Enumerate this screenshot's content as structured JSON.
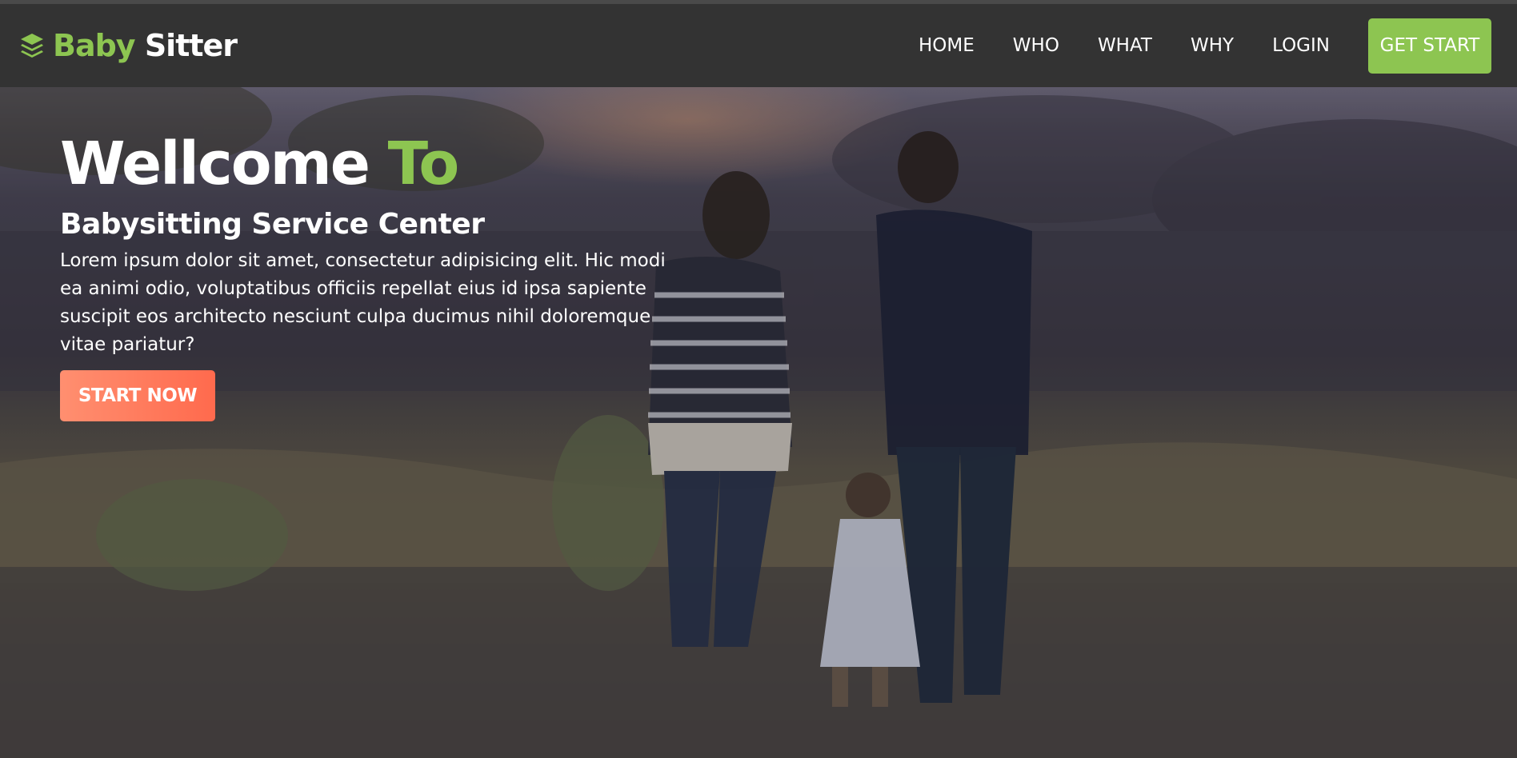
{
  "brand": {
    "logo_icon": "stacked-layers-icon",
    "name_part1": "Baby",
    "name_part2": "Sitter",
    "accent_color": "#8dc551"
  },
  "nav": {
    "items": [
      {
        "label": "HOME"
      },
      {
        "label": "WHO"
      },
      {
        "label": "WHAT"
      },
      {
        "label": "WHY"
      },
      {
        "label": "LOGIN"
      }
    ],
    "cta_label": "GET START",
    "cta_color": "#8dc551"
  },
  "hero": {
    "title_main": "Wellcome",
    "title_accent": "To",
    "subtitle": "Babysitting Service Center",
    "body": "Lorem ipsum dolor sit amet, consectetur adipisicing elit. Hic modi ea animi odio, voluptatibus officiis repellat eius id ipsa sapiente suscipit eos architecto nesciunt culpa ducimus nihil doloremque vitae pariatur?",
    "button_label": "START NOW",
    "button_color": "#ff7a5c",
    "background_image": "family-walking-at-sunset-photo"
  }
}
